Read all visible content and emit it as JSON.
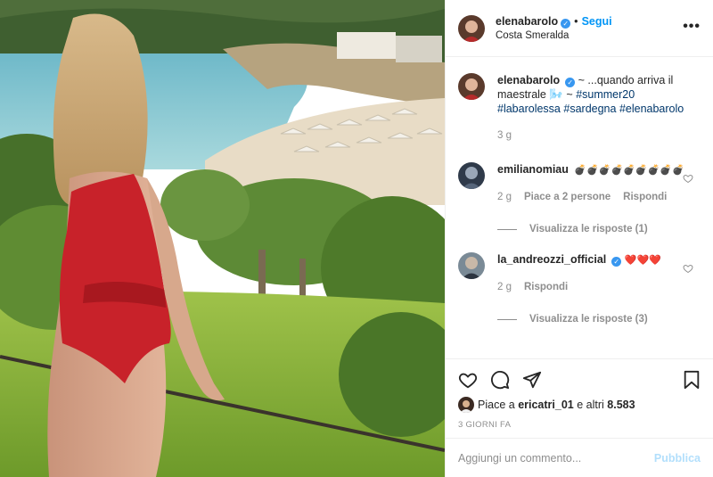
{
  "header": {
    "username": "elenabarolo",
    "follow_label": "Segui",
    "location": "Costa Smeralda",
    "more_label": "•••"
  },
  "caption": {
    "username": "elenabarolo",
    "text": "~ ...quando arriva il maestrale 🌬️ ~",
    "hashtags": [
      "#summer20",
      "#labarolessa",
      "#sardegna",
      "#elenabarolo"
    ],
    "time": "3 g"
  },
  "comments": [
    {
      "username": "emilianomiau",
      "text": "💣💣💣💣💣💣💣💣💣",
      "time": "2 g",
      "likes": "Piace a 2 persone",
      "reply": "Rispondi",
      "view_replies": "Visualizza le risposte (1)"
    },
    {
      "username": "la_andreozzi_official",
      "text": "❤️❤️❤️",
      "time": "2 g",
      "reply": "Rispondi",
      "view_replies": "Visualizza le risposte (3)"
    }
  ],
  "likes": {
    "prefix": "Piace a",
    "user": "ericatri_01",
    "suffix": "e altri",
    "count": "8.583"
  },
  "timestamp": "3 GIORNI FA",
  "composer": {
    "placeholder": "Aggiungi un commento...",
    "publish_label": "Pubblica"
  },
  "colors": {
    "link": "#0095f6",
    "hashtag": "#00376b",
    "verified": "#3897f0",
    "muted": "#8e8e8e"
  }
}
